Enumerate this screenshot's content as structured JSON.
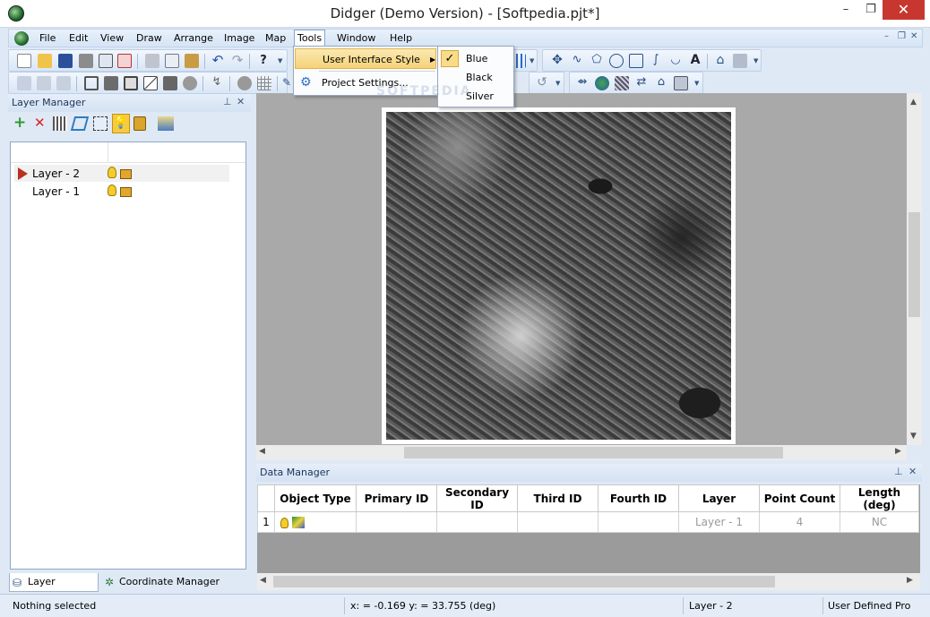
{
  "window": {
    "title": "Didger (Demo Version) - [Softpedia.pjt*]",
    "min": "–",
    "max": "❐",
    "close": "✕"
  },
  "menubar": {
    "items": [
      "File",
      "Edit",
      "View",
      "Draw",
      "Arrange",
      "Image",
      "Map",
      "Tools",
      "Window",
      "Help"
    ],
    "mdi_min": "–",
    "mdi_restore": "❐",
    "mdi_close": "✕"
  },
  "tools_menu": {
    "items": [
      "User Interface Style",
      "Project Settings..."
    ]
  },
  "style_submenu": {
    "items": [
      "Blue",
      "Black",
      "Silver"
    ],
    "selected": "Blue",
    "check": "✓"
  },
  "layer_manager": {
    "title": "Layer Manager",
    "pin": "⊥",
    "close": "✕",
    "layers": [
      "Layer - 2",
      "Layer - 1"
    ]
  },
  "data_manager": {
    "title": "Data Manager",
    "pin": "⊥",
    "close": "✕",
    "columns": [
      "Object Type",
      "Primary ID",
      "Secondary ID",
      "Third ID",
      "Fourth ID",
      "Layer",
      "Point Count",
      "Length (deg)"
    ],
    "rows": [
      {
        "num": "1",
        "primary": "",
        "secondary": "",
        "third": "",
        "fourth": "",
        "layer": "Layer - 1",
        "count": "4",
        "length": "NC"
      }
    ]
  },
  "tabs": {
    "layer": "Layer Manager",
    "coord": "Coordinate Manager"
  },
  "status": {
    "selection": "Nothing selected",
    "coords": "x: = -0.169 y: = 33.755 (deg)",
    "layer": "Layer - 2",
    "projection": "User Defined Pro"
  },
  "watermark": "SOFTPEDIA",
  "colors": {
    "accent": "#1c3358",
    "panel": "#dfe9f5",
    "close_red": "#c7372f"
  }
}
